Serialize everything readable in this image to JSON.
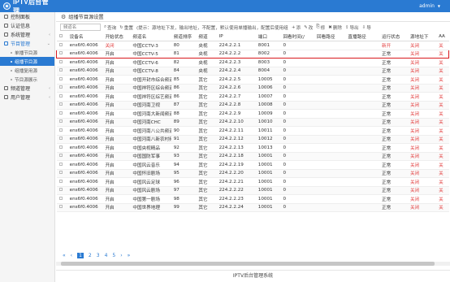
{
  "header": {
    "title": "IPTV后台管理",
    "user": "admin",
    "user_caret": "▼"
  },
  "sidebar": {
    "items": [
      {
        "label": "控制面板"
      },
      {
        "label": "认证信息"
      },
      {
        "label": "系统管理",
        "arrow": "‹"
      },
      {
        "label": "节目管理",
        "arrow": "⌄"
      },
      {
        "label": "频道管理",
        "arrow": "‹"
      },
      {
        "label": "用户管理",
        "arrow": "‹"
      }
    ],
    "sub_items": [
      {
        "label": "单播节目源"
      },
      {
        "label": "组播节目源"
      },
      {
        "label": "组播复用源"
      },
      {
        "label": "节目源展示"
      }
    ]
  },
  "page": {
    "title": "组播节目源设置"
  },
  "toolbar": {
    "search_placeholder": "频道名",
    "query": "查询",
    "reset": "重置",
    "hint": "(提示：源地址下发，输出地址，不配置，默认使用单播输出，配置后使用组播输出，不用",
    "add": "添",
    "edit": "改",
    "copy": "修",
    "delete": "删除",
    "export": "导出",
    "import": "导"
  },
  "table": {
    "columns": [
      "",
      "设备名",
      "开始状态",
      "频道名",
      "频道排序",
      "频道",
      "IP",
      "端口",
      "回看时间(/",
      "回看路径",
      "直播路径",
      "运行状态",
      "源地址下",
      "AA"
    ],
    "rows": [
      [
        "",
        "ens6f0.4006",
        "关闭",
        "中国CCTV-3",
        "80",
        "央视",
        "224.2.2.1",
        "8001",
        "0",
        "",
        "",
        "新开",
        "关闭",
        "关"
      ],
      [
        "",
        "ens6f0.4006",
        "开启",
        "中国CCTV-5",
        "81",
        "央视",
        "224.2.2.2",
        "8002",
        "0",
        "",
        "",
        "正常",
        "关闭",
        "关"
      ],
      [
        "",
        "ens6f0.4006",
        "开启",
        "中国CCTV-6",
        "82",
        "央视",
        "224.2.2.3",
        "8003",
        "0",
        "",
        "",
        "正常",
        "关闭",
        "关"
      ],
      [
        "",
        "ens6f0.4006",
        "开启",
        "中国CCTV-8",
        "84",
        "央视",
        "224.2.2.4",
        "8004",
        "0",
        "",
        "",
        "正常",
        "关闭",
        "关"
      ],
      [
        "",
        "ens6f0.4006",
        "开启",
        "中国开封市综合频道",
        "85",
        "其它",
        "224.2.2.5",
        "10005",
        "0",
        "",
        "",
        "正常",
        "关闭",
        "关"
      ],
      [
        "",
        "ens6f0.4006",
        "开启",
        "中国祥符区综合频道",
        "86",
        "其它",
        "224.2.2.6",
        "10006",
        "0",
        "",
        "",
        "正常",
        "关闭",
        "关"
      ],
      [
        "",
        "ens6f0.4006",
        "开启",
        "中国祥符区综艺频道",
        "86",
        "其它",
        "224.2.2.7",
        "10007",
        "0",
        "",
        "",
        "正常",
        "关闭",
        "关"
      ],
      [
        "",
        "ens6f0.4006",
        "开启",
        "中国河南卫视",
        "87",
        "其它",
        "224.2.2.8",
        "10008",
        "0",
        "",
        "",
        "正常",
        "关闭",
        "关"
      ],
      [
        "",
        "ens6f0.4006",
        "开启",
        "中国河南大新闻频道",
        "88",
        "其它",
        "224.2.2.9",
        "10009",
        "0",
        "",
        "",
        "正常",
        "关闭",
        "关"
      ],
      [
        "",
        "ens6f0.4006",
        "开启",
        "中国河南CHC",
        "89",
        "其它",
        "224.2.2.10",
        "10010",
        "0",
        "",
        "",
        "正常",
        "关闭",
        "关"
      ],
      [
        "",
        "ens6f0.4006",
        "开启",
        "中国河南八公共频道",
        "90",
        "其它",
        "224.2.2.11",
        "10011",
        "0",
        "",
        "",
        "正常",
        "关闭",
        "关"
      ],
      [
        "",
        "ens6f0.4006",
        "开启",
        "中国河南八新农村频",
        "91",
        "其它",
        "224.2.2.12",
        "10012",
        "0",
        "",
        "",
        "正常",
        "关闭",
        "关"
      ],
      [
        "",
        "ens6f0.4006",
        "开启",
        "中国央视精品",
        "92",
        "其它",
        "224.2.2.13",
        "10013",
        "0",
        "",
        "",
        "正常",
        "关闭",
        "关"
      ],
      [
        "",
        "ens6f0.4006",
        "开启",
        "中国国防军事",
        "93",
        "其它",
        "224.2.2.18",
        "10001",
        "0",
        "",
        "",
        "正常",
        "关闭",
        "关"
      ],
      [
        "",
        "ens6f0.4006",
        "开启",
        "中国风云音乐",
        "94",
        "其它",
        "224.2.2.19",
        "10001",
        "0",
        "",
        "",
        "正常",
        "关闭",
        "关"
      ],
      [
        "",
        "ens6f0.4006",
        "开启",
        "中国怀旧剧场",
        "95",
        "其它",
        "224.2.2.20",
        "10001",
        "0",
        "",
        "",
        "正常",
        "关闭",
        "关"
      ],
      [
        "",
        "ens6f0.4006",
        "开启",
        "中国风云足球",
        "96",
        "其它",
        "224.2.2.21",
        "10001",
        "0",
        "",
        "",
        "正常",
        "关闭",
        "关"
      ],
      [
        "",
        "ens6f0.4006",
        "开启",
        "中国风云剧场",
        "97",
        "其它",
        "224.2.2.22",
        "10001",
        "0",
        "",
        "",
        "正常",
        "关闭",
        "关"
      ],
      [
        "",
        "ens6f0.4006",
        "开启",
        "中国第一剧场",
        "98",
        "其它",
        "224.2.2.23",
        "10001",
        "0",
        "",
        "",
        "正常",
        "关闭",
        "关"
      ],
      [
        "",
        "ens6f0.4006",
        "开启",
        "中国世界地理",
        "99",
        "其它",
        "224.2.2.24",
        "10001",
        "0",
        "",
        "",
        "正常",
        "关闭",
        "关"
      ]
    ]
  },
  "pager": {
    "prev_first": "«",
    "prev": "‹",
    "pages": [
      "1",
      "2",
      "3",
      "4",
      "5"
    ],
    "next": "›",
    "last": "»"
  },
  "footer": {
    "text": "IPTV后台管理系统"
  },
  "colors": {
    "accent": "#2a7ad2",
    "danger": "#e23c3c",
    "highlight_border": "#d9191e"
  }
}
